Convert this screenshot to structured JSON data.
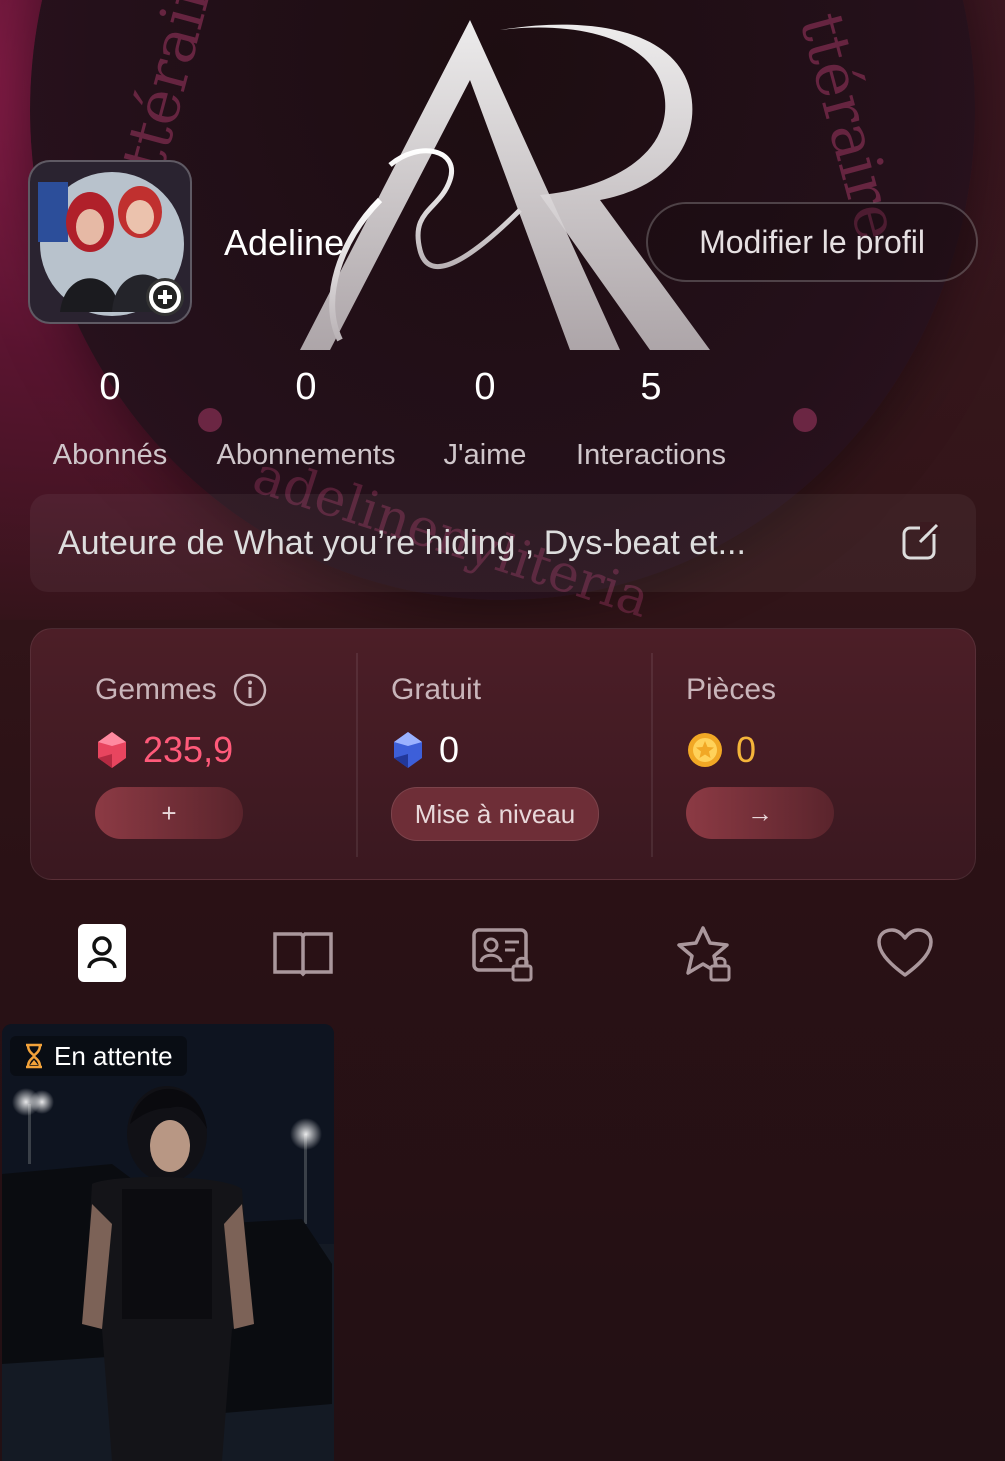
{
  "profile": {
    "username": "Adeline",
    "edit_button": "Modifier le profil",
    "avatar_icon": "plus-circle-icon"
  },
  "banner": {
    "circle_text_top": "ure littéraire",
    "circle_text_bottom": "adelinenyliteria",
    "logo_letters": "AR"
  },
  "stats": [
    {
      "value": "0",
      "label": "Abonnés"
    },
    {
      "value": "0",
      "label": "Abonnements"
    },
    {
      "value": "0",
      "label": "J'aime"
    },
    {
      "value": "5",
      "label": "Interactions"
    }
  ],
  "bio": {
    "text": "Auteure de What you’re hiding , Dys-beat et...",
    "icon": "edit-icon"
  },
  "wallet": {
    "gems": {
      "label": "Gemmes",
      "value": "235,9",
      "button": "+",
      "color": "#ff5a7a",
      "icon": "red-gem-icon",
      "info_icon": "info-icon"
    },
    "free": {
      "label": "Gratuit",
      "value": "0",
      "button": "Mise à niveau",
      "color": "#ffffff",
      "icon": "blue-gem-icon"
    },
    "coins": {
      "label": "Pièces",
      "value": "0",
      "button": "→",
      "color": "#f5b53a",
      "icon": "coin-icon"
    }
  },
  "tabs": [
    {
      "icon": "profile-icon",
      "active": true
    },
    {
      "icon": "book-icon",
      "active": false
    },
    {
      "icon": "id-card-lock-icon",
      "active": false
    },
    {
      "icon": "star-lock-icon",
      "active": false
    },
    {
      "icon": "heart-icon",
      "active": false
    }
  ],
  "card": {
    "status": "En attente",
    "status_icon": "hourglass-icon"
  }
}
